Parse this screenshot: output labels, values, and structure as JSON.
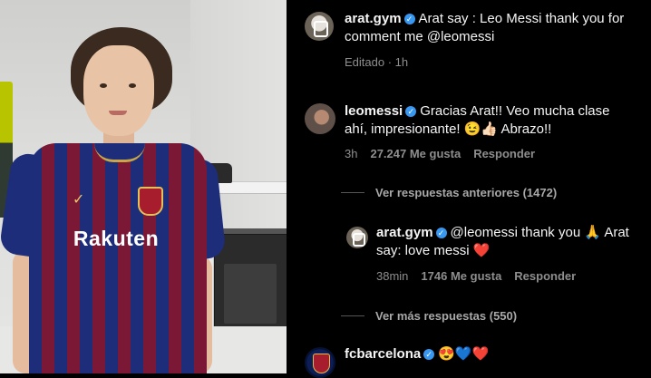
{
  "post": {
    "author": "arat.gym",
    "caption": "Arat say : Leo Messi thank you for comment me @leomessi",
    "caption_line1": "Arat say : Leo Messi thank you for",
    "caption_line2": "comment me @leomessi",
    "edited": "Editado · 1h",
    "photo_sponsor": "Rakuten"
  },
  "comments": [
    {
      "author": "leomessi",
      "text_line1": "Gracias Arat!! Veo mucha clase",
      "text_line2": "ahí, impresionante!",
      "emoji": "😉👍🏻",
      "text_tail": "Abrazo!!",
      "time": "3h",
      "likes": "27.247 Me gusta",
      "reply": "Responder"
    },
    {
      "author": "arat.gym",
      "text_line1": "@leomessi thank you 🙏 Arat",
      "text_line2": "say: love messi",
      "emoji": "❤️",
      "time": "38min",
      "likes": "1746 Me gusta",
      "reply": "Responder"
    },
    {
      "author": "fcbarcelona",
      "emoji": "😍💙❤️"
    }
  ],
  "links": {
    "previous_replies": "Ver respuestas anteriores (1472)",
    "more_replies": "Ver más respuestas (550)"
  },
  "colors": {
    "background": "#000000",
    "verified": "#3897f0",
    "meta": "#8e8e8e"
  }
}
